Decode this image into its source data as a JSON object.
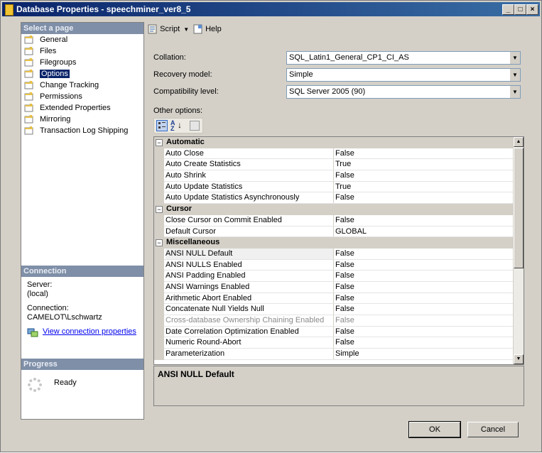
{
  "window": {
    "title": "Database Properties - speechminer_ver8_5"
  },
  "left_pane": {
    "select_page_header": "Select a page",
    "pages": [
      {
        "label": "General",
        "selected": false
      },
      {
        "label": "Files",
        "selected": false
      },
      {
        "label": "Filegroups",
        "selected": false
      },
      {
        "label": "Options",
        "selected": true
      },
      {
        "label": "Change Tracking",
        "selected": false
      },
      {
        "label": "Permissions",
        "selected": false
      },
      {
        "label": "Extended Properties",
        "selected": false
      },
      {
        "label": "Mirroring",
        "selected": false
      },
      {
        "label": "Transaction Log Shipping",
        "selected": false
      }
    ],
    "connection": {
      "header": "Connection",
      "server_label": "Server:",
      "server_value": "(local)",
      "connection_label": "Connection:",
      "connection_value": "CAMELOT\\Lschwartz",
      "view_link": "View connection properties"
    },
    "progress": {
      "header": "Progress",
      "status": "Ready"
    }
  },
  "toolbar": {
    "script_label": "Script",
    "help_label": "Help"
  },
  "form": {
    "collation": {
      "label": "Collation:",
      "value": "SQL_Latin1_General_CP1_CI_AS"
    },
    "recovery_model": {
      "label": "Recovery model:",
      "value": "Simple"
    },
    "compatibility_level": {
      "label": "Compatibility level:",
      "value": "SQL Server 2005 (90)"
    },
    "other_options_label": "Other options:"
  },
  "grid": {
    "categories": [
      {
        "name": "Automatic",
        "props": [
          {
            "name": "Auto Close",
            "value": "False"
          },
          {
            "name": "Auto Create Statistics",
            "value": "True"
          },
          {
            "name": "Auto Shrink",
            "value": "False"
          },
          {
            "name": "Auto Update Statistics",
            "value": "True"
          },
          {
            "name": "Auto Update Statistics Asynchronously",
            "value": "False"
          }
        ]
      },
      {
        "name": "Cursor",
        "props": [
          {
            "name": "Close Cursor on Commit Enabled",
            "value": "False"
          },
          {
            "name": "Default Cursor",
            "value": "GLOBAL"
          }
        ]
      },
      {
        "name": "Miscellaneous",
        "props": [
          {
            "name": "ANSI NULL Default",
            "value": "False",
            "selected": true
          },
          {
            "name": "ANSI NULLS Enabled",
            "value": "False"
          },
          {
            "name": "ANSI Padding Enabled",
            "value": "False"
          },
          {
            "name": "ANSI Warnings Enabled",
            "value": "False"
          },
          {
            "name": "Arithmetic Abort Enabled",
            "value": "False"
          },
          {
            "name": "Concatenate Null Yields Null",
            "value": "False"
          },
          {
            "name": "Cross-database Ownership Chaining Enabled",
            "value": "False",
            "disabled": true
          },
          {
            "name": "Date Correlation Optimization Enabled",
            "value": "False"
          },
          {
            "name": "Numeric Round-Abort",
            "value": "False"
          },
          {
            "name": "Parameterization",
            "value": "Simple"
          }
        ]
      }
    ],
    "description_title": "ANSI NULL Default"
  },
  "buttons": {
    "ok": "OK",
    "cancel": "Cancel"
  }
}
